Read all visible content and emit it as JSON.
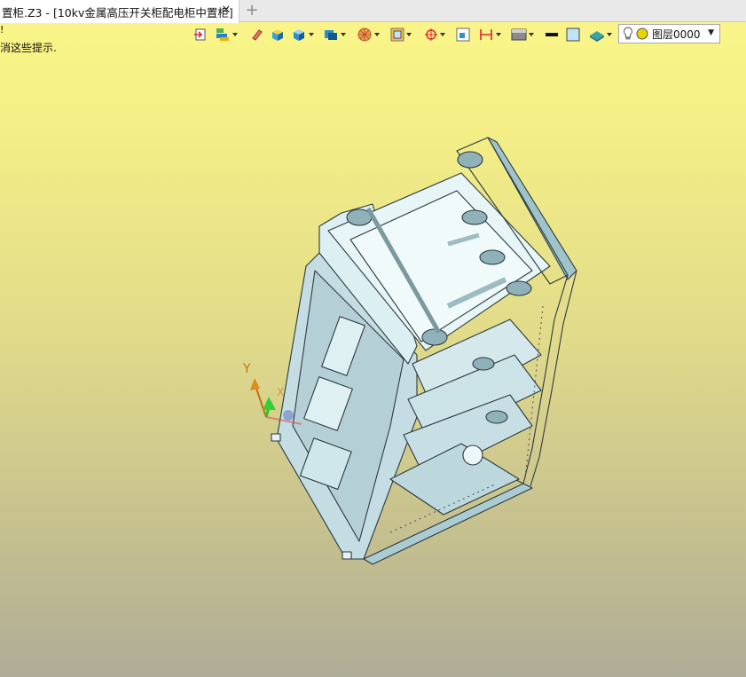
{
  "tab": {
    "title": "置柜.Z3 - [10kv金属高压开关柜配电柜中置柜]",
    "close": "✕",
    "new": "+"
  },
  "hint": {
    "line1": "!",
    "line2": "消这些提示."
  },
  "toolbar": {
    "icons": [
      "import-icon",
      "layers-icon",
      "eraser-icon",
      "box-shaded-icon",
      "cube-icon",
      "view-cube-icon",
      "sphere-icon",
      "frame-icon",
      "crosshair-icon",
      "window-icon",
      "dimension-icon",
      "background-icon",
      "line-color-icon",
      "fill-color-icon",
      "surface-icon"
    ],
    "layer": {
      "name": "图层0000",
      "dropdown": "▼"
    }
  },
  "axis": {
    "y_label": "Y",
    "x_label": "X"
  },
  "colors": {
    "bg_top": "#fbf688",
    "bg_bottom": "#afac98",
    "model_fill": "#cfe6ea",
    "model_stroke": "#2d3a40"
  }
}
